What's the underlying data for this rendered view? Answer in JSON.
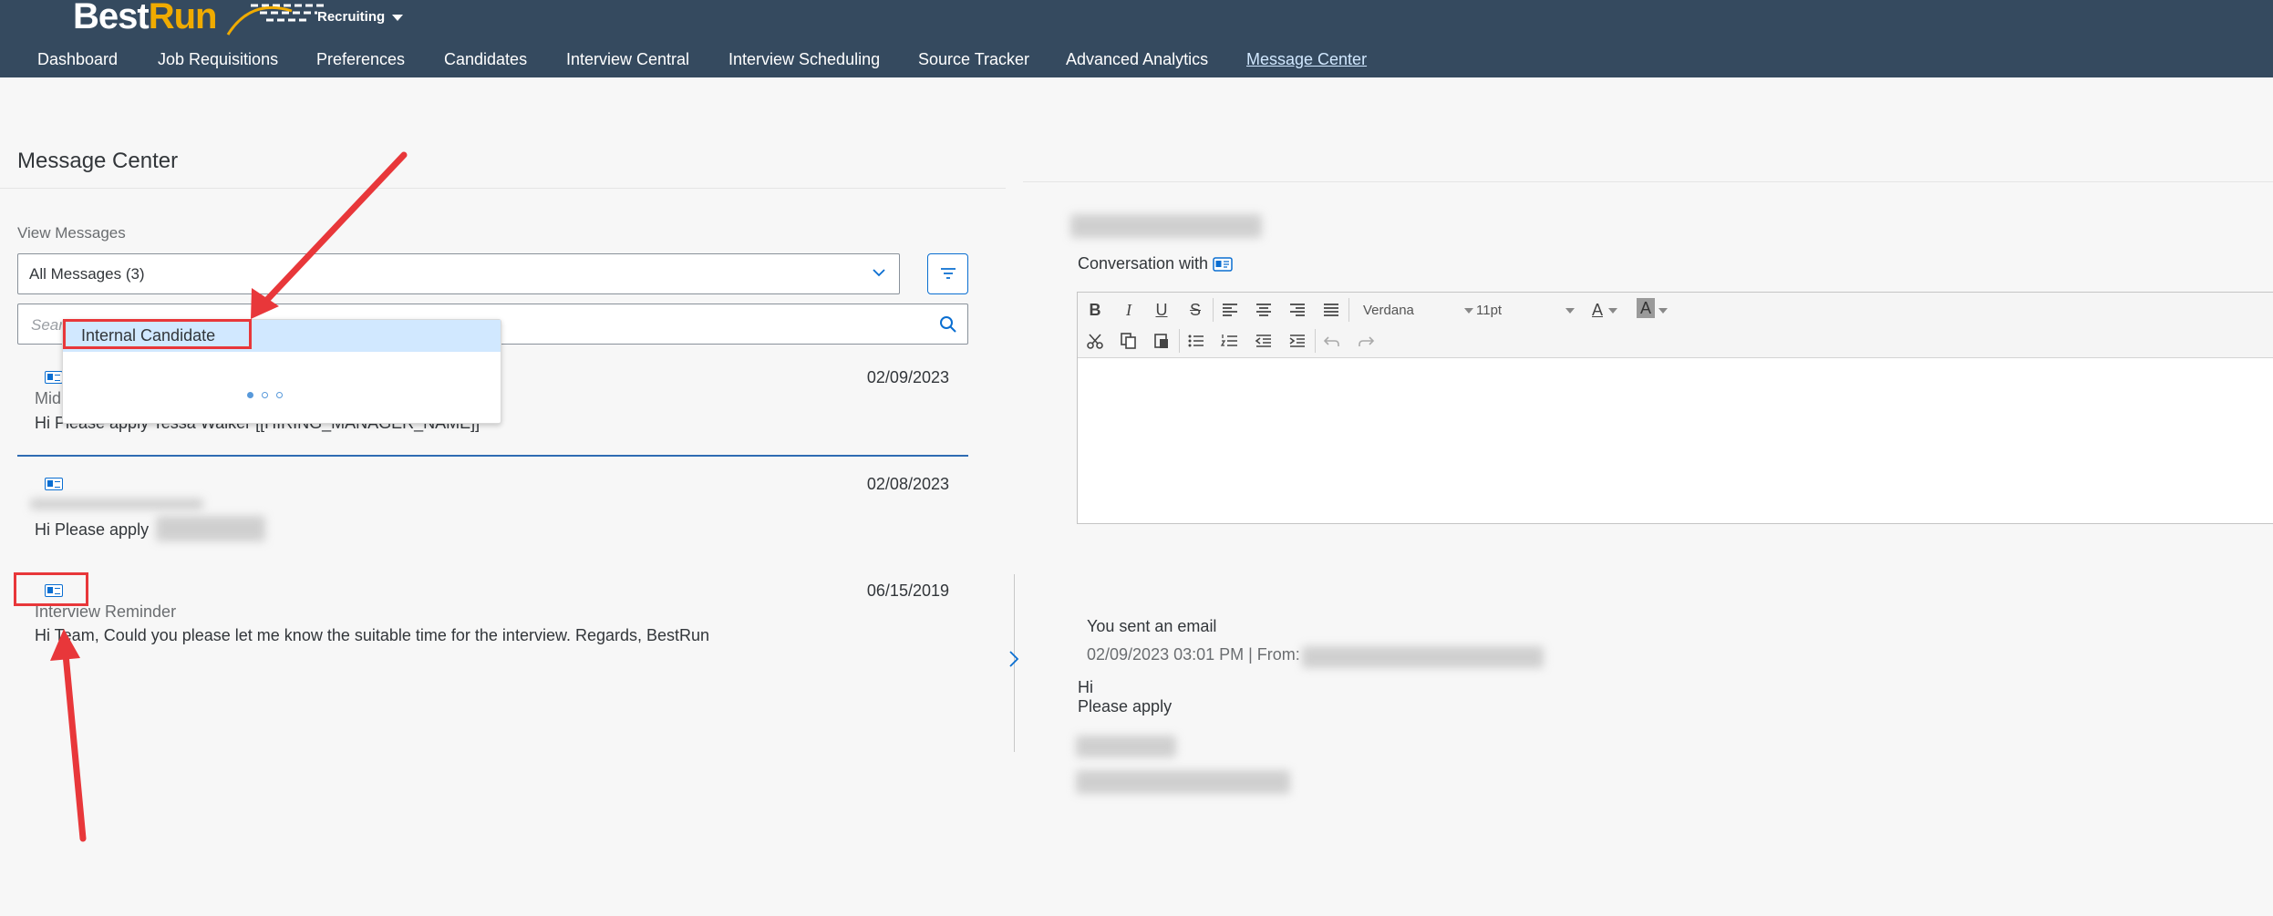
{
  "header": {
    "logo_best": "Best",
    "logo_run": "Run",
    "module": "Recruiting",
    "nav": [
      {
        "label": "Dashboard"
      },
      {
        "label": "Job Requisitions"
      },
      {
        "label": "Preferences"
      },
      {
        "label": "Candidates"
      },
      {
        "label": "Interview Central"
      },
      {
        "label": "Interview Scheduling"
      },
      {
        "label": "Source Tracker"
      },
      {
        "label": "Advanced Analytics"
      },
      {
        "label": "Message Center"
      }
    ]
  },
  "left": {
    "title": "Message Center",
    "view_label": "View Messages",
    "select_value": "All Messages (3)",
    "search_placeholder": "Search Mes",
    "popup_option": "Internal Candidate",
    "messages": [
      {
        "date": "02/09/2023",
        "subject": "Mid",
        "body": "Hi  Please apply  Tessa Walker [[HIRING_MANAGER_NAME]]"
      },
      {
        "date": "02/08/2023",
        "subject": "",
        "body": "Hi  Please apply"
      },
      {
        "date": "06/15/2019",
        "subject": "Interview Reminder",
        "body": "Hi Team,  Could you please let me know the suitable time for the interview. Regards, BestRun"
      }
    ]
  },
  "right": {
    "conversation_label": "Conversation with",
    "font_name": "Verdana",
    "font_size": "11pt",
    "sent_label": "You sent an email",
    "sent_meta": "02/09/2023 03:01 PM   | From:",
    "body_line1": "Hi",
    "body_line2": "Please apply"
  },
  "colors": {
    "header_bg": "#354a5f",
    "accent": "#0a6ed1",
    "logo_orange": "#f0ab00",
    "annotation_red": "#e8373a"
  }
}
